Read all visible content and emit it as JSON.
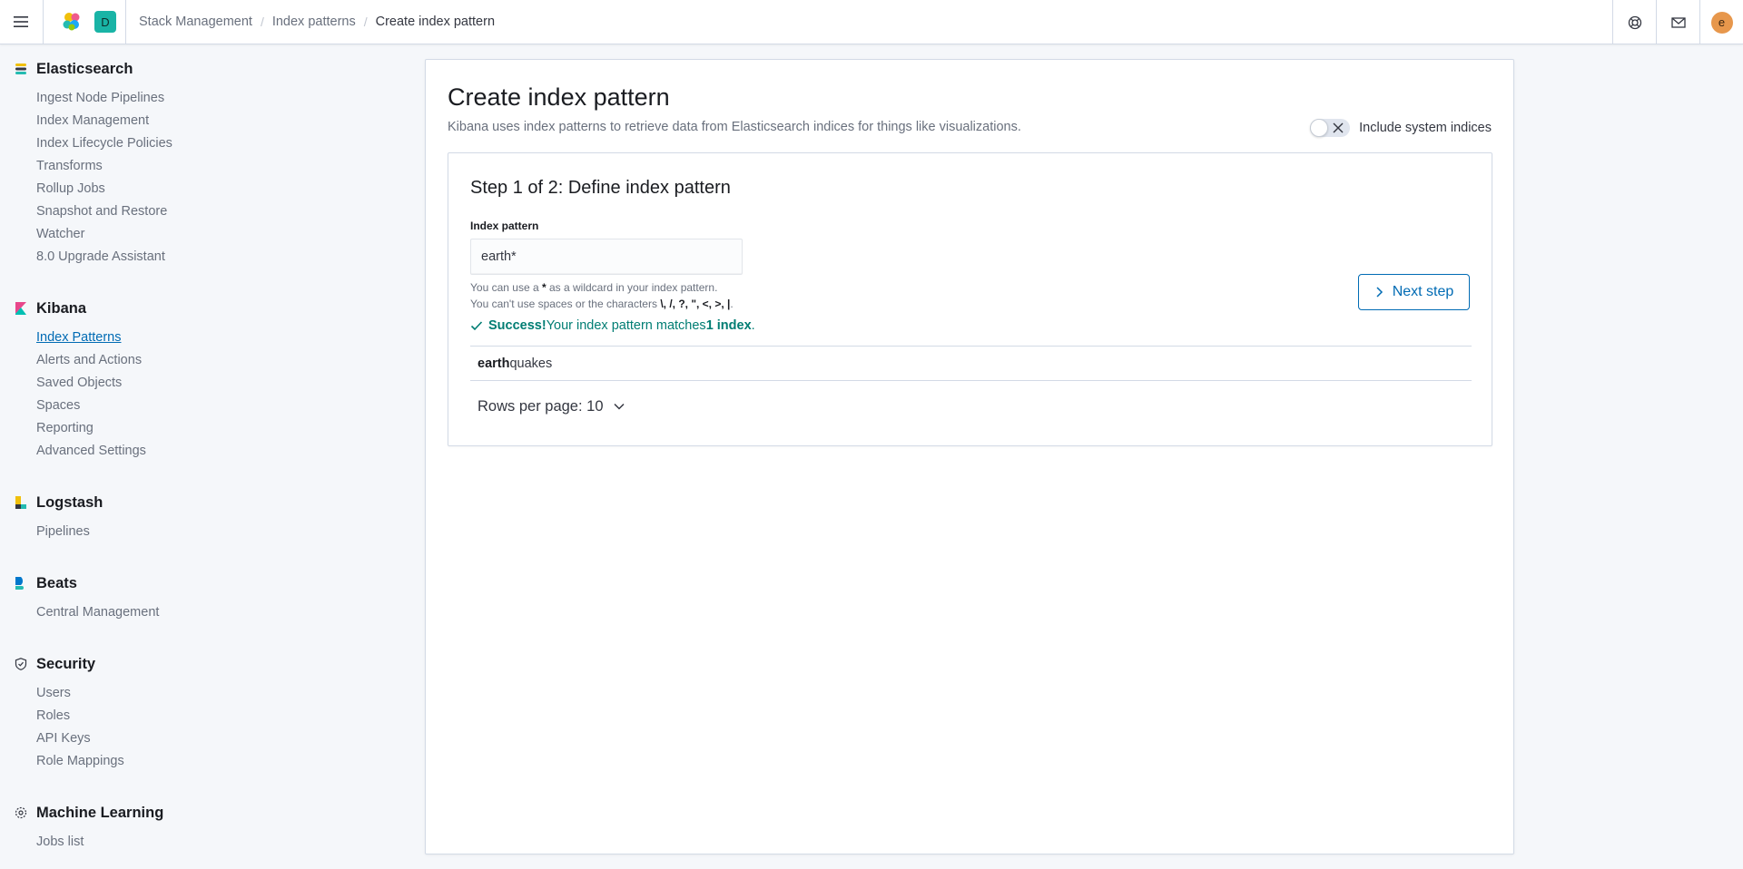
{
  "header": {
    "space_initial": "D",
    "user_initial": "e",
    "breadcrumbs": [
      "Stack Management",
      "Index patterns",
      "Create index pattern"
    ],
    "icons": [
      "menu-icon",
      "elastic-logo-icon",
      "help-icon",
      "newsfeed-icon"
    ]
  },
  "sidebar": {
    "sections": [
      {
        "title": "Elasticsearch",
        "icon": "elasticsearch-icon",
        "items": [
          "Ingest Node Pipelines",
          "Index Management",
          "Index Lifecycle Policies",
          "Transforms",
          "Rollup Jobs",
          "Snapshot and Restore",
          "Watcher",
          "8.0 Upgrade Assistant"
        ]
      },
      {
        "title": "Kibana",
        "icon": "kibana-icon",
        "items": [
          "Index Patterns",
          "Alerts and Actions",
          "Saved Objects",
          "Spaces",
          "Reporting",
          "Advanced Settings"
        ],
        "active": "Index Patterns"
      },
      {
        "title": "Logstash",
        "icon": "logstash-icon",
        "items": [
          "Pipelines"
        ]
      },
      {
        "title": "Beats",
        "icon": "beats-icon",
        "items": [
          "Central Management"
        ]
      },
      {
        "title": "Security",
        "icon": "security-icon",
        "items": [
          "Users",
          "Roles",
          "API Keys",
          "Role Mappings"
        ]
      },
      {
        "title": "Machine Learning",
        "icon": "machine-learning-icon",
        "items": [
          "Jobs list"
        ]
      }
    ]
  },
  "main": {
    "title": "Create index pattern",
    "description": "Kibana uses index patterns to retrieve data from Elasticsearch indices for things like visualizations.",
    "system_indices_label": "Include system indices",
    "system_indices_on": false,
    "step": {
      "title": "Step 1 of 2: Define index pattern",
      "field_label": "Index pattern",
      "field_value": "earth*",
      "help_line1_pre": "You can use a ",
      "help_line1_bold": "*",
      "help_line1_post": " as a wildcard in your index pattern.",
      "help_line2_pre": "You can't use spaces or the characters ",
      "help_line2_bold": "\\, /, ?, \", <, >, |",
      "help_line2_post": ".",
      "next_label": "Next step",
      "success_bold": "Success!",
      "success_mid": " Your index pattern matches ",
      "success_count": "1 index",
      "success_end": ".",
      "match_bold": "earth",
      "match_rest": "quakes",
      "rows_per_page": "Rows per page: 10"
    }
  },
  "colors": {
    "accent": "#006bb4",
    "success": "#017d73",
    "space_avatar": "#19b4a6",
    "user_avatar": "#e7974c"
  }
}
